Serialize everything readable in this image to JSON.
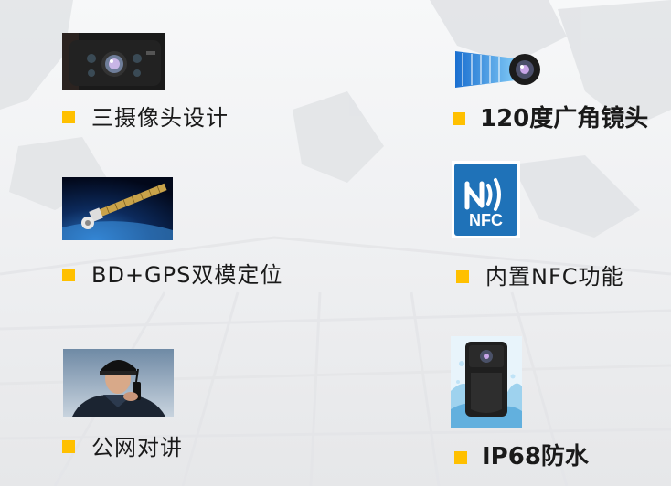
{
  "features": [
    {
      "label": "三摄像头设计",
      "icon": "triple-camera-icon"
    },
    {
      "label": "120度广角镜头",
      "icon": "wide-angle-lens-icon"
    },
    {
      "label": "BD+GPS双模定位",
      "icon": "satellite-icon"
    },
    {
      "label": "内置NFC功能",
      "icon": "nfc-icon",
      "badge_text": "NFC"
    },
    {
      "label": "公网对讲",
      "icon": "walkie-talkie-officer-icon"
    },
    {
      "label": "IP68防水",
      "icon": "waterproof-camera-icon"
    }
  ],
  "colors": {
    "bullet": "#ffc000",
    "nfc_badge": "#1f72b8",
    "text": "#1a1a1a"
  }
}
